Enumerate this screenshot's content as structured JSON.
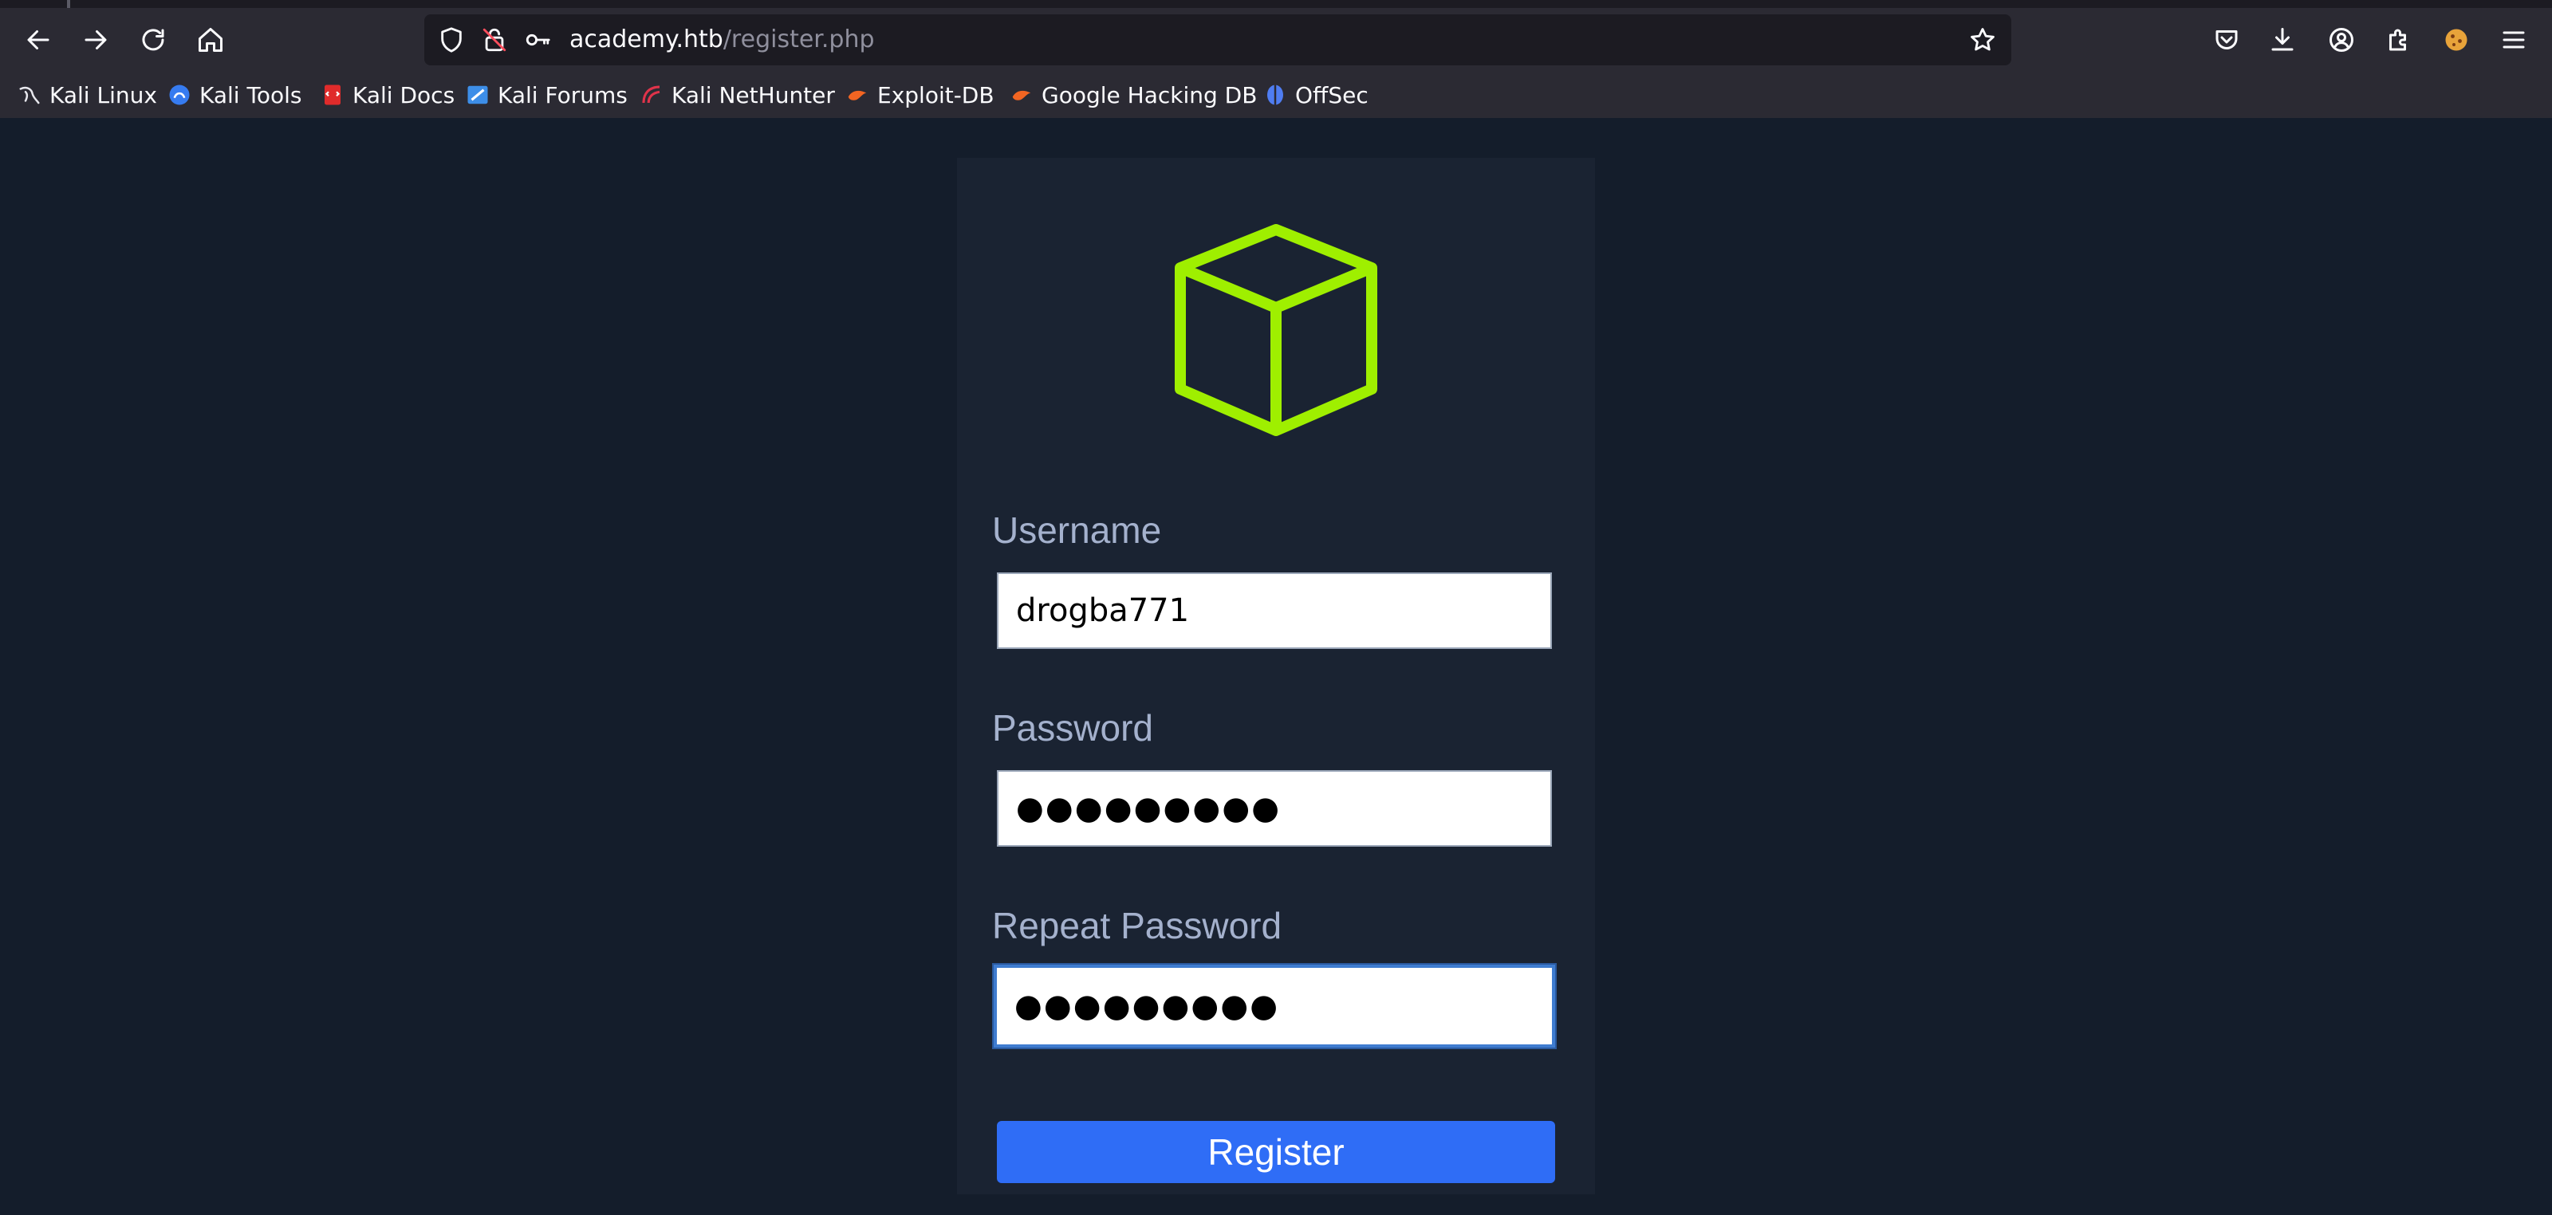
{
  "browser": {
    "url_host": "academy.htb",
    "url_path": "/register.php",
    "bookmarks": [
      {
        "label": "Kali Linux",
        "icon": "kali-dragon-icon"
      },
      {
        "label": "Kali Tools",
        "icon": "kali-tools-icon"
      },
      {
        "label": "Kali Docs",
        "icon": "kali-docs-icon"
      },
      {
        "label": "Kali Forums",
        "icon": "kali-forums-icon"
      },
      {
        "label": "Kali NetHunter",
        "icon": "kali-nethunter-icon"
      },
      {
        "label": "Exploit-DB",
        "icon": "exploit-db-icon"
      },
      {
        "label": "Google Hacking DB",
        "icon": "ghdb-icon"
      },
      {
        "label": "OffSec",
        "icon": "offsec-icon"
      }
    ]
  },
  "form": {
    "username_label": "Username",
    "username_value": "drogba771",
    "password_label": "Password",
    "password_value": "●●●●●●●●●",
    "repeat_label": "Repeat Password",
    "repeat_value": "●●●●●●●●●",
    "register_label": "Register"
  },
  "colors": {
    "accent": "#9fef00",
    "button": "#2f6df6",
    "background": "#141d2b",
    "card": "#1a2332"
  }
}
